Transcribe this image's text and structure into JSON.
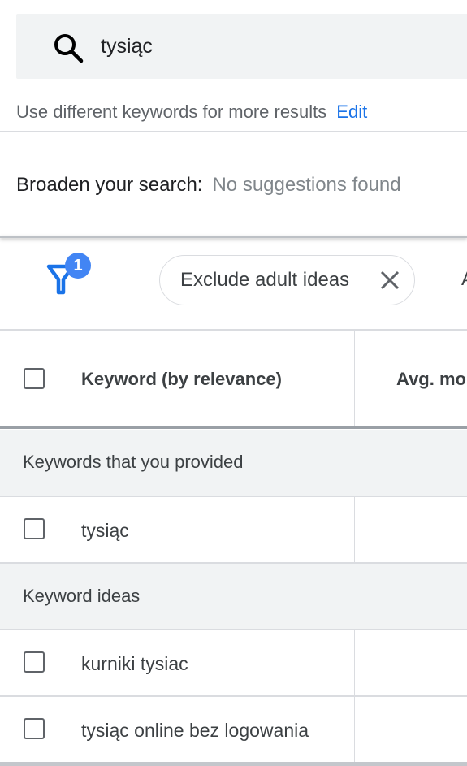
{
  "search": {
    "query": "tysiąc",
    "icon": "search-icon"
  },
  "hint": {
    "text": "Use different keywords for more results",
    "edit_label": "Edit"
  },
  "broaden": {
    "label": "Broaden your search:",
    "value": "No suggestions found"
  },
  "filters": {
    "badge_count": "1",
    "chip_label": "Exclude adult ideas",
    "next_chip_fragment": "A"
  },
  "table": {
    "columns": [
      "Keyword (by relevance)",
      "Avg. mo"
    ],
    "groups": [
      {
        "title": "Keywords that you provided",
        "rows": [
          "tysiąc"
        ]
      },
      {
        "title": "Keyword ideas",
        "rows": [
          "kurniki tysiac",
          "tysiąc online bez logowania"
        ]
      }
    ]
  },
  "colors": {
    "accent": "#1a73e8",
    "badge": "#4285f4"
  }
}
